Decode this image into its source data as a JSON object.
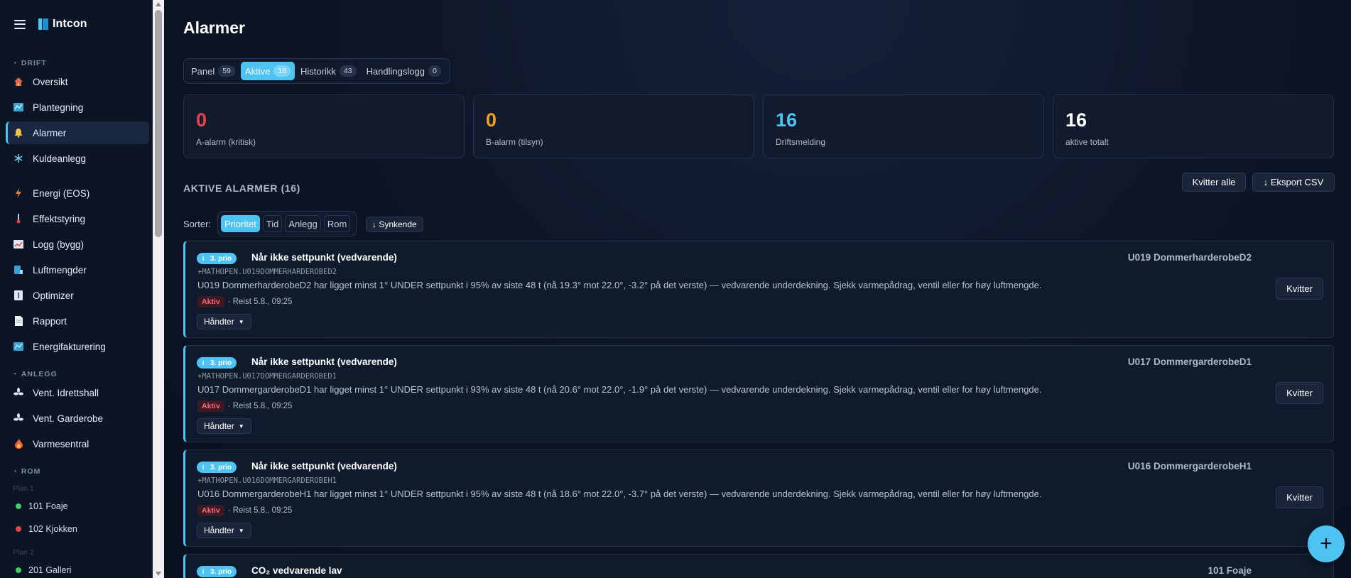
{
  "app": {
    "name": "Intcon"
  },
  "sidebar": {
    "sections": {
      "drift": "DRIFT",
      "anlegg": "ANLEGG",
      "rom": "ROM"
    },
    "drift_items": [
      {
        "label": "Oversikt",
        "icon": "house-icon"
      },
      {
        "label": "Plantegning",
        "icon": "map-icon"
      },
      {
        "label": "Alarmer",
        "icon": "bell-icon"
      },
      {
        "label": "Kuldeanlegg",
        "icon": "snowflake-icon"
      },
      {
        "label": "Energi (EOS)",
        "icon": "lightning-icon"
      },
      {
        "label": "Effektstyring",
        "icon": "thermometer-icon"
      },
      {
        "label": "Logg (bygg)",
        "icon": "chart-icon"
      },
      {
        "label": "Luftmengder",
        "icon": "gauge-icon"
      },
      {
        "label": "Optimizer",
        "icon": "bars-icon"
      },
      {
        "label": "Rapport",
        "icon": "document-icon"
      },
      {
        "label": "Energifakturering",
        "icon": "map-icon"
      }
    ],
    "anlegg_items": [
      {
        "label": "Vent. Idrettshall",
        "icon": "fan-icon"
      },
      {
        "label": "Vent. Garderobe",
        "icon": "fan-icon"
      },
      {
        "label": "Varmesentral",
        "icon": "fire-icon"
      }
    ],
    "floors": [
      {
        "label": "Plan 1",
        "rooms": [
          {
            "label": "101 Foaje",
            "status": "green"
          },
          {
            "label": "102 Kjokken",
            "status": "red"
          }
        ]
      },
      {
        "label": "Plan 2",
        "rooms": [
          {
            "label": "201 Galleri",
            "status": "green"
          }
        ]
      }
    ]
  },
  "main": {
    "title": "Alarmer",
    "tabs": [
      {
        "label": "Panel",
        "count": "59"
      },
      {
        "label": "Aktive",
        "count": "16"
      },
      {
        "label": "Historikk",
        "count": "43"
      },
      {
        "label": "Handlingslogg",
        "count": "0"
      }
    ],
    "stats": [
      {
        "value": "0",
        "label": "A-alarm (kritisk)",
        "color": "#e8424f"
      },
      {
        "value": "0",
        "label": "B-alarm (tilsyn)",
        "color": "#f0a020"
      },
      {
        "value": "16",
        "label": "Driftsmelding",
        "color": "#4cc3f0"
      },
      {
        "value": "16",
        "label": "aktive totalt",
        "color": "#ffffff"
      }
    ],
    "section_title": "AKTIVE ALARMER (16)",
    "ack_all": "Kvitter alle",
    "export_csv": "↓ Eksport CSV",
    "sort": {
      "label": "Sorter:",
      "options": [
        "Prioritet",
        "Tid",
        "Anlegg",
        "Rom"
      ],
      "direction": "↓ Synkende"
    },
    "alarms": [
      {
        "prio": "3. prio",
        "title": "Når ikke settpunkt (vedvarende)",
        "code": "+MATHOPEN.U019DOMMERHARDEROBED2",
        "description": "U019 DommerharderobeD2 har ligget minst 1° UNDER settpunkt i 95% av siste 48 t (nå 19.3° mot 22.0°, -3.2° på det verste) — vedvarende underdekning. Sjekk varmepådrag, ventil eller for høy luftmengde.",
        "status": "Aktiv",
        "time": "· Reist 5.8., 09:25",
        "handle": "Håndter",
        "room": "U019 DommerharderobeD2",
        "ack": "Kvitter"
      },
      {
        "prio": "3. prio",
        "title": "Når ikke settpunkt (vedvarende)",
        "code": "+MATHOPEN.U017DOMMERGARDEROBED1",
        "description": "U017 DommergarderobeD1 har ligget minst 1° UNDER settpunkt i 93% av siste 48 t (nå 20.6° mot 22.0°, -1.9° på det verste) — vedvarende underdekning. Sjekk varmepådrag, ventil eller for høy luftmengde.",
        "status": "Aktiv",
        "time": "· Reist 5.8., 09:25",
        "handle": "Håndter",
        "room": "U017 DommergarderobeD1",
        "ack": "Kvitter"
      },
      {
        "prio": "3. prio",
        "title": "Når ikke settpunkt (vedvarende)",
        "code": "+MATHOPEN.U016DOMMERGARDEROBEH1",
        "description": "U016 DommergarderobeH1 har ligget minst 1° UNDER settpunkt i 95% av siste 48 t (nå 18.6° mot 22.0°, -3.7° på det verste) — vedvarende underdekning. Sjekk varmepådrag, ventil eller for høy luftmengde.",
        "status": "Aktiv",
        "time": "· Reist 5.8., 09:25",
        "handle": "Håndter",
        "room": "U016 DommergarderobeH1",
        "ack": "Kvitter"
      },
      {
        "prio": "3. prio",
        "title": "CO₂ vedvarende lav",
        "room": "101 Foaje"
      }
    ],
    "fab": "+"
  }
}
